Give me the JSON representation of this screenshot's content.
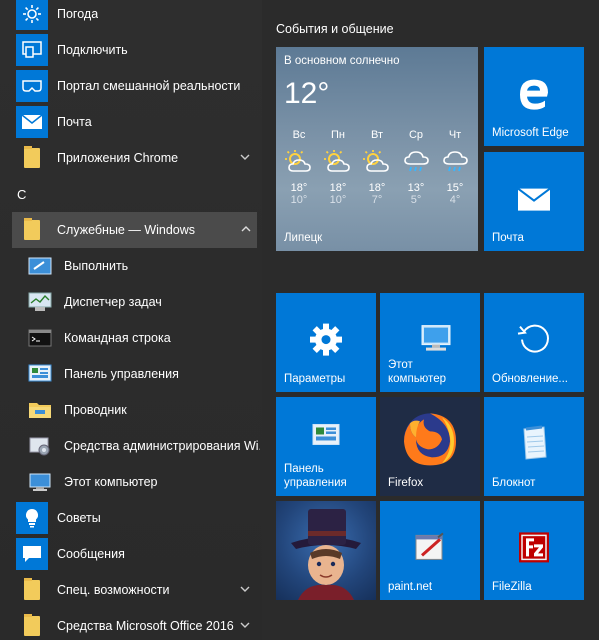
{
  "applist": {
    "items_top": [
      {
        "label": "Погода",
        "icon": "sun-icon"
      },
      {
        "label": "Подключить",
        "icon": "connect-icon"
      },
      {
        "label": "Портал смешанной реальности",
        "icon": "mixed-reality-icon"
      },
      {
        "label": "Почта",
        "icon": "mail-icon"
      },
      {
        "label": "Приложения Chrome",
        "icon": "folder-icon"
      }
    ],
    "section_letter": "С",
    "expanded_folder": {
      "label": "Служебные — Windows",
      "icon": "folder-icon"
    },
    "sub_items": [
      {
        "label": "Выполнить",
        "icon": "run-icon"
      },
      {
        "label": "Диспетчер задач",
        "icon": "task-manager-icon"
      },
      {
        "label": "Командная строка",
        "icon": "command-prompt-icon"
      },
      {
        "label": "Панель управления",
        "icon": "control-panel-icon"
      },
      {
        "label": "Проводник",
        "icon": "explorer-icon"
      },
      {
        "label": "Средства администрирования Wi...",
        "icon": "admin-tools-icon"
      },
      {
        "label": "Этот компьютер",
        "icon": "computer-icon"
      }
    ],
    "items_bottom": [
      {
        "label": "Советы",
        "icon": "lightbulb-icon"
      },
      {
        "label": "Сообщения",
        "icon": "message-icon"
      },
      {
        "label": "Спец. возможности",
        "icon": "folder-icon"
      },
      {
        "label": "Средства Microsoft Office 2016",
        "icon": "folder-icon"
      }
    ]
  },
  "tiles": {
    "group_title": "События и общение",
    "weather": {
      "condition": "В основном солнечно",
      "temperature": "12°",
      "city": "Липецк",
      "days": [
        {
          "name": "Вс",
          "high": "18°",
          "low": "10°",
          "icon": "partly-cloudy-icon"
        },
        {
          "name": "Пн",
          "high": "18°",
          "low": "10°",
          "icon": "partly-cloudy-icon"
        },
        {
          "name": "Вт",
          "high": "18°",
          "low": "7°",
          "icon": "partly-cloudy-icon"
        },
        {
          "name": "Ср",
          "high": "13°",
          "low": "5°",
          "icon": "rain-icon"
        },
        {
          "name": "Чт",
          "high": "15°",
          "low": "4°",
          "icon": "rain-icon"
        }
      ]
    },
    "edge": {
      "label": "Microsoft Edge"
    },
    "mail": {
      "label": "Почта"
    },
    "settings": {
      "label": "Параметры"
    },
    "this_pc": {
      "label": "Этот компьютер"
    },
    "updates": {
      "label": "Обновление..."
    },
    "control_panel": {
      "label": "Панель управления"
    },
    "firefox": {
      "label": "Firefox"
    },
    "notepad": {
      "label": "Блокнот"
    },
    "game": {
      "label": ""
    },
    "paintnet": {
      "label": "paint.net"
    },
    "filezilla": {
      "label": "FileZilla"
    }
  },
  "colors": {
    "accent": "#0078d7",
    "background": "#2b2b2b",
    "expanded_row": "#4b4b4b"
  }
}
